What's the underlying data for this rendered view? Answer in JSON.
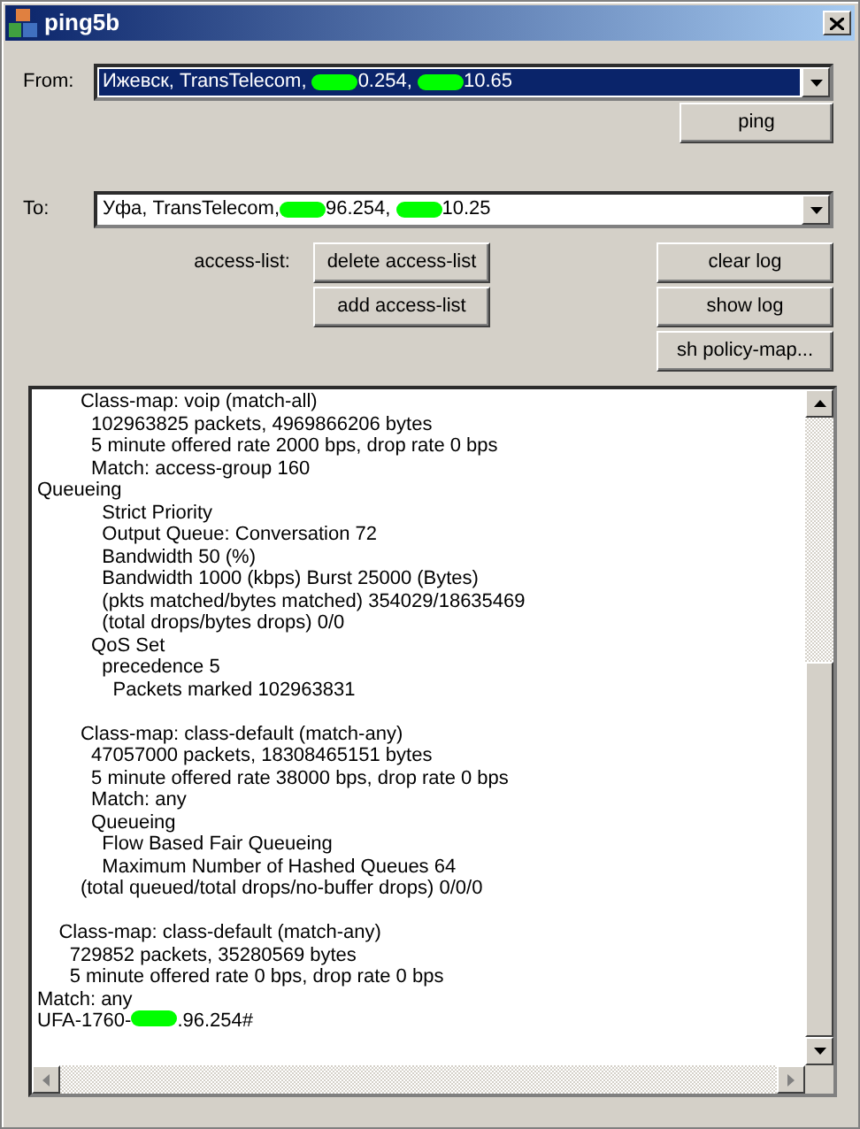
{
  "window": {
    "title": "ping5b"
  },
  "from": {
    "label": "From:",
    "selected": true,
    "parts": [
      {
        "kind": "text",
        "text": "Ижевск, TransTelecom, "
      },
      {
        "kind": "redaction"
      },
      {
        "kind": "text",
        "text": "0.254, "
      },
      {
        "kind": "redaction"
      },
      {
        "kind": "text",
        "text": "10.65"
      }
    ]
  },
  "ping_button": "ping",
  "to": {
    "label": "To:",
    "selected": false,
    "parts": [
      {
        "kind": "text",
        "text": "Уфа, TransTelecom,"
      },
      {
        "kind": "redaction"
      },
      {
        "kind": "text",
        "text": "96.254, "
      },
      {
        "kind": "redaction"
      },
      {
        "kind": "text",
        "text": "10.25"
      }
    ]
  },
  "access_list": {
    "label": "access-list:",
    "buttons": [
      "delete access-list",
      "add access-list"
    ]
  },
  "log_buttons": [
    "clear log",
    "show log",
    "sh policy-map..."
  ],
  "log": {
    "blocks": [
      [
        "        Class-map: voip (match-all)",
        "          102963825 packets, 4969866206 bytes",
        "          5 minute offered rate 2000 bps, drop rate 0 bps",
        "          Match: access-group 160",
        "Queueing",
        "            Strict Priority",
        "            Output Queue: Conversation 72",
        "            Bandwidth 50 (%)",
        "            Bandwidth 1000 (kbps) Burst 25000 (Bytes)",
        "            (pkts matched/bytes matched) 354029/18635469",
        "            (total drops/bytes drops) 0/0",
        "          QoS Set",
        "            precedence 5",
        "              Packets marked 102963831"
      ],
      [
        "        Class-map: class-default (match-any)",
        "          47057000 packets, 18308465151 bytes",
        "          5 minute offered rate 38000 bps, drop rate 0 bps",
        "          Match: any",
        "          Queueing",
        "            Flow Based Fair Queueing",
        "            Maximum Number of Hashed Queues 64",
        "        (total queued/total drops/no-buffer drops) 0/0/0"
      ],
      [
        "    Class-map: class-default (match-any)",
        "      729852 packets, 35280569 bytes",
        "      5 minute offered rate 0 bps, drop rate 0 bps",
        "Match: any"
      ]
    ],
    "prompt": [
      {
        "kind": "text",
        "text": "UFA-1760-"
      },
      {
        "kind": "redaction"
      },
      {
        "kind": "text",
        "text": ".96.254#"
      }
    ]
  }
}
